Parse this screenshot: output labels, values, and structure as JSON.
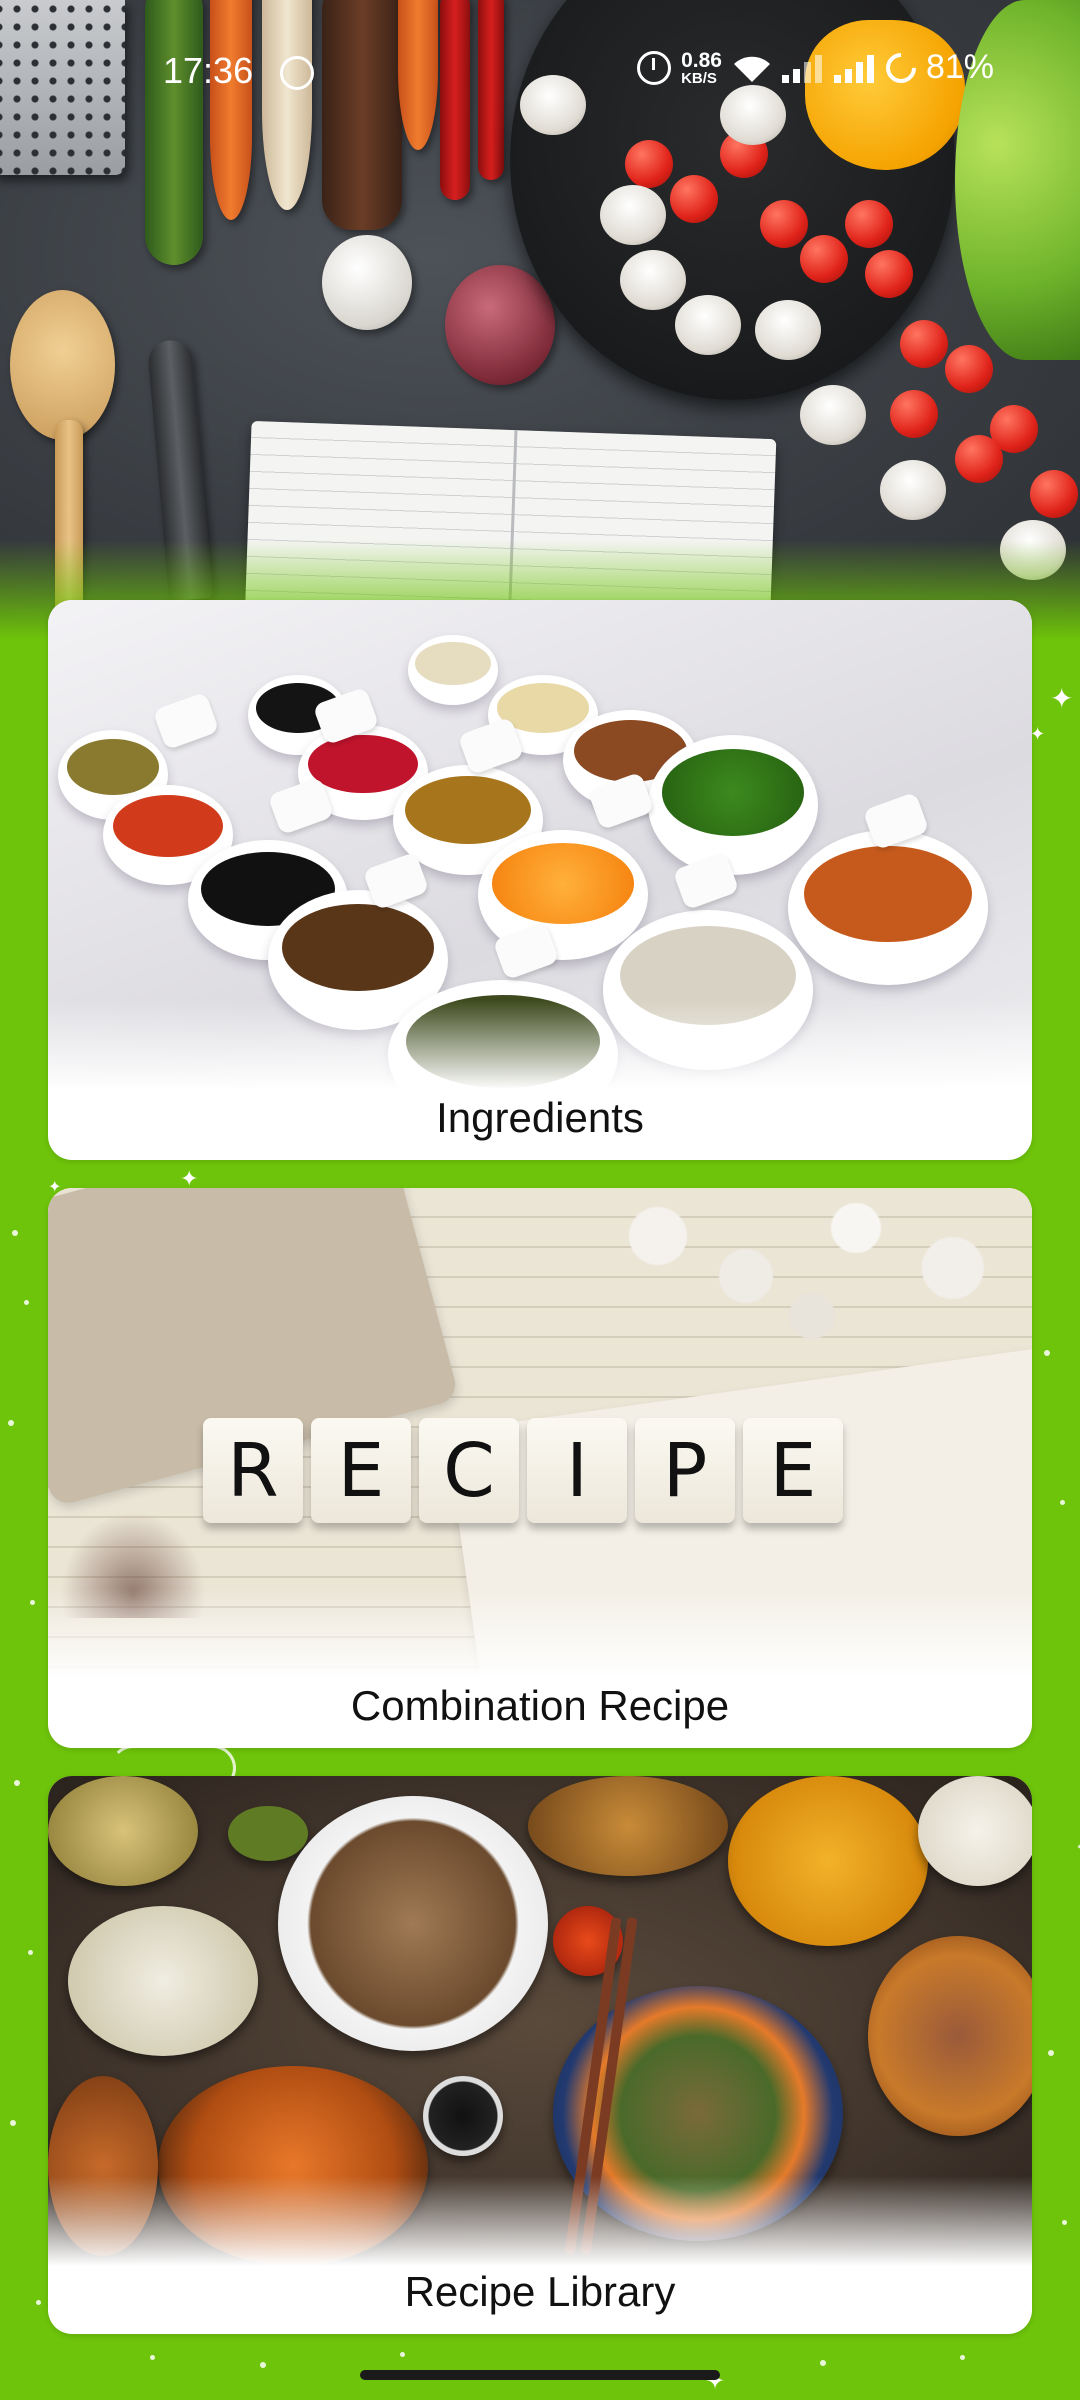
{
  "status_bar": {
    "time": "17:36",
    "network_speed_value": "0.86",
    "network_speed_unit": "KB/S",
    "battery": "81%",
    "icons": [
      "whatsapp-icon",
      "alarm-icon",
      "wifi-icon",
      "signal-icon",
      "signal-icon",
      "battery-icon"
    ]
  },
  "cards": [
    {
      "label": "Ingredients"
    },
    {
      "label": "Combination Recipe"
    },
    {
      "label": "Recipe Library"
    }
  ],
  "recipe_tiles": [
    "R",
    "E",
    "C",
    "I",
    "P",
    "E"
  ],
  "colors": {
    "background": "#6ec40a",
    "card": "#ffffff",
    "label_text": "#111111"
  }
}
